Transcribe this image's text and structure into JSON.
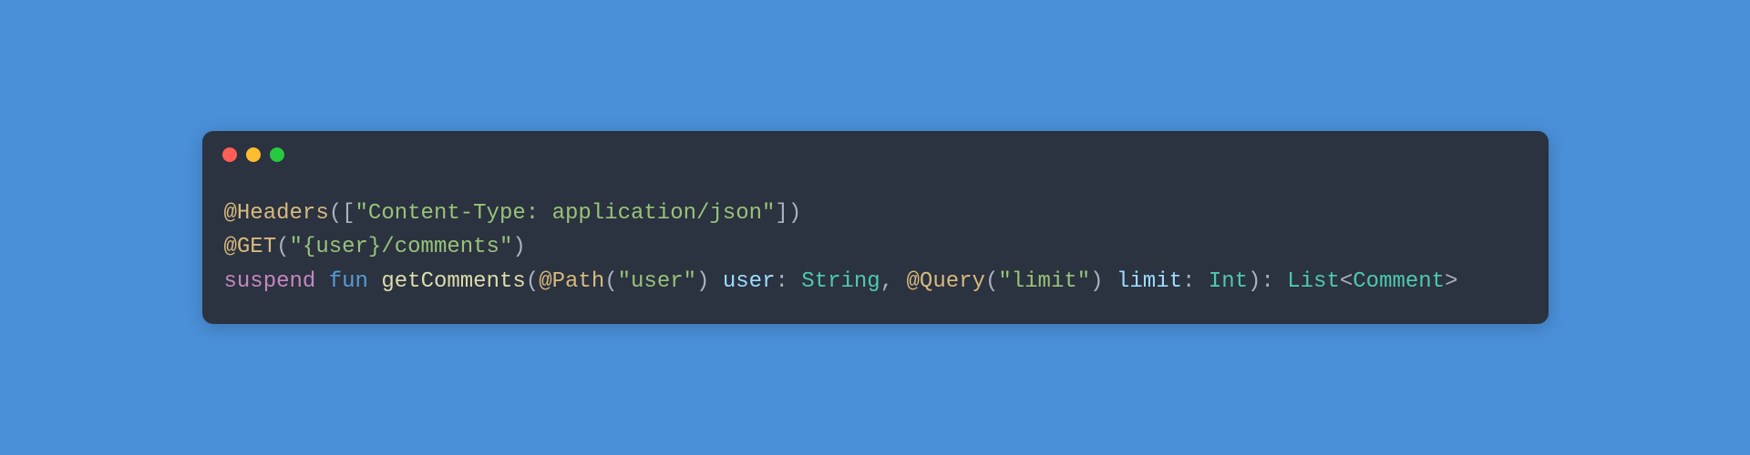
{
  "window": {
    "dots": [
      "red",
      "yellow",
      "green"
    ]
  },
  "code": {
    "line1": {
      "annotation": "@Headers",
      "openParen": "(",
      "openBracket": "[",
      "string": "\"Content-Type: application/json\"",
      "closeBracket": "]",
      "closeParen": ")"
    },
    "line2": {
      "annotation": "@GET",
      "openParen": "(",
      "string": "\"{user}/comments\"",
      "closeParen": ")"
    },
    "line3": {
      "keyword_suspend": "suspend",
      "keyword_fun": "fun",
      "funcname": "getComments",
      "openParen": "(",
      "annotation_path": "@Path",
      "path_open": "(",
      "path_string": "\"user\"",
      "path_close": ")",
      "param_user": "user",
      "colon1": ":",
      "type_string": "String",
      "comma": ",",
      "annotation_query": "@Query",
      "query_open": "(",
      "query_string": "\"limit\"",
      "query_close": ")",
      "param_limit": "limit",
      "colon2": ":",
      "type_int": "Int",
      "closeParen": ")",
      "colon3": ":",
      "type_list": "List",
      "lt": "<",
      "type_comment": "Comment",
      "gt": ">"
    }
  }
}
